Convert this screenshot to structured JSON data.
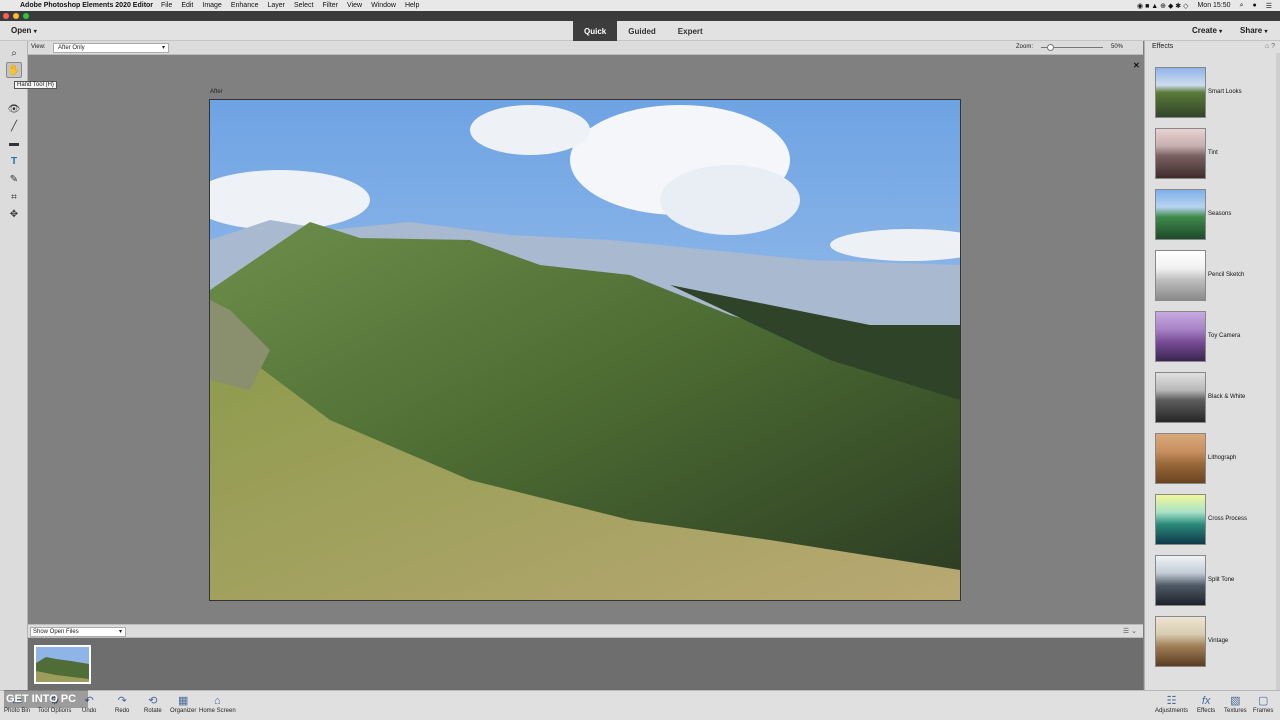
{
  "menubar": {
    "app_name": "Adobe Photoshop Elements 2020 Editor",
    "items": [
      "File",
      "Edit",
      "Image",
      "Enhance",
      "Layer",
      "Select",
      "Filter",
      "View",
      "Window",
      "Help"
    ],
    "clock": "Mon 15:50"
  },
  "appbar": {
    "open_label": "Open",
    "modes": [
      "Quick",
      "Guided",
      "Expert"
    ],
    "active_mode": "Quick",
    "create_label": "Create",
    "share_label": "Share"
  },
  "tools": {
    "tooltip": "Hand Tool (H)"
  },
  "options": {
    "view_label": "View:",
    "view_value": "After Only",
    "zoom_label": "Zoom:",
    "zoom_value": "50%",
    "zoom_fraction": 0.15
  },
  "canvas": {
    "after_label": "After"
  },
  "effects_panel": {
    "title": "Effects",
    "items": [
      "Smart Looks",
      "Tint",
      "Seasons",
      "Pencil Sketch",
      "Toy Camera",
      "Black & White",
      "Lithograph",
      "Cross Process",
      "Split Tone",
      "Vintage"
    ]
  },
  "photo_bin": {
    "show_label": "Show Open Files"
  },
  "bottom": {
    "photo_bin": "Photo Bin",
    "tool_options": "Tool Options",
    "undo": "Undo",
    "redo": "Redo",
    "rotate": "Rotate",
    "organizer": "Organizer",
    "home_screen": "Home Screen",
    "adjustments": "Adjustments",
    "effects": "Effects",
    "textures": "Textures",
    "frames": "Frames"
  },
  "watermark": "GET INTO PC",
  "colors": {
    "active_mode_bg": "#3d3d3d",
    "canvas_bg": "#808080",
    "panel_bg": "#dfdfdf"
  }
}
